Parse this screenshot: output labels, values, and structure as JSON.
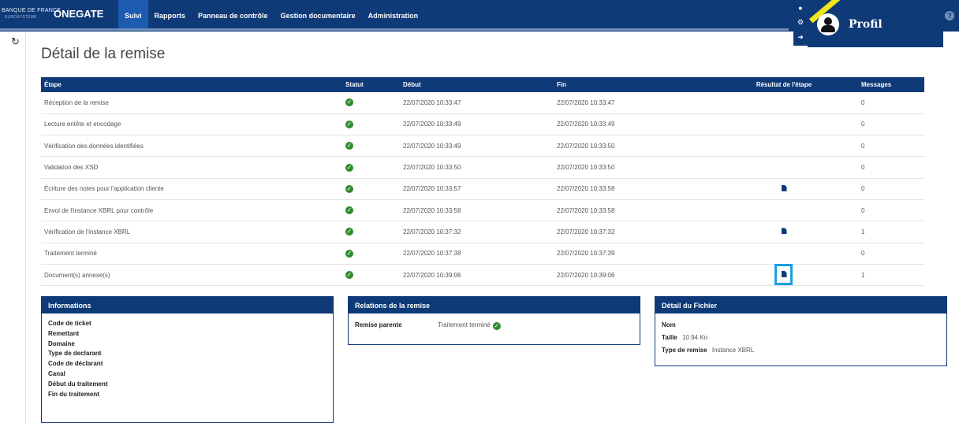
{
  "header": {
    "brand_small": "BANQUE DE FRANCE",
    "brand_sub": "EUROSYSTÈME",
    "app_name": "ONEGATE",
    "nav": [
      "Suivi",
      "Rapports",
      "Panneau de contrôle",
      "Gestion documentaire",
      "Administration"
    ],
    "active_nav": "Suivi",
    "profile_label": "Profil",
    "help": "?"
  },
  "page": {
    "title": "Détail de la remise"
  },
  "steps_table": {
    "columns": [
      "Étape",
      "Statut",
      "Début",
      "Fin",
      "Résultat de l'étape",
      "Messages"
    ],
    "rows": [
      {
        "step": "Réception de la remise",
        "debut": "22/07/2020 10:33:47",
        "fin": "22/07/2020 10:33:47",
        "doc": false,
        "messages": "0"
      },
      {
        "step": "Lecture entête et encodage",
        "debut": "22/07/2020 10:33:49",
        "fin": "22/07/2020 10:33:49",
        "doc": false,
        "messages": "0"
      },
      {
        "step": "Vérification des données identifiées",
        "debut": "22/07/2020 10:33:49",
        "fin": "22/07/2020 10:33:50",
        "doc": false,
        "messages": "0"
      },
      {
        "step": "Validation des XSD",
        "debut": "22/07/2020 10:33:50",
        "fin": "22/07/2020 10:33:50",
        "doc": false,
        "messages": "0"
      },
      {
        "step": "Écriture des notes pour l'application cliente",
        "debut": "22/07/2020 10:33:57",
        "fin": "22/07/2020 10:33:58",
        "doc": true,
        "messages": "0"
      },
      {
        "step": "Envoi de l'instance XBRL pour contrôle",
        "debut": "22/07/2020 10:33:58",
        "fin": "22/07/2020 10:33:58",
        "doc": false,
        "messages": "0"
      },
      {
        "step": "Vérification de l'instance XBRL",
        "debut": "22/07/2020 10:37:32",
        "fin": "22/07/2020 10:37:32",
        "doc": true,
        "messages": "1"
      },
      {
        "step": "Traitement terminé",
        "debut": "22/07/2020 10:37:38",
        "fin": "22/07/2020 10:37:39",
        "doc": false,
        "messages": "0"
      },
      {
        "step": "Document(s) annexe(s)",
        "debut": "22/07/2020 10:39:06",
        "fin": "22/07/2020 10:39:06",
        "doc": true,
        "highlight": true,
        "messages": "1"
      }
    ]
  },
  "informations": {
    "title": "Informations",
    "fields": [
      "Code de ticket",
      "Remettant",
      "Domaine",
      "Type de declarant",
      "Code de déclarant",
      "Canal",
      "Début du traitement",
      "Fin du traitement"
    ]
  },
  "relations": {
    "title": "Relations de la remise",
    "label": "Remise parente",
    "value": "Traitement terminé"
  },
  "fichier": {
    "title": "Détail du Fichier",
    "nom_label": "Nom",
    "taille_label": "Taille",
    "taille_value": "10.94 Ko",
    "type_label": "Type de remise",
    "type_value": "Instance XBRL"
  },
  "colors": {
    "primary": "#0e3a78",
    "active_nav": "#1d5bb0",
    "success": "#2e8b2e",
    "highlight": "#1aa0e0"
  }
}
